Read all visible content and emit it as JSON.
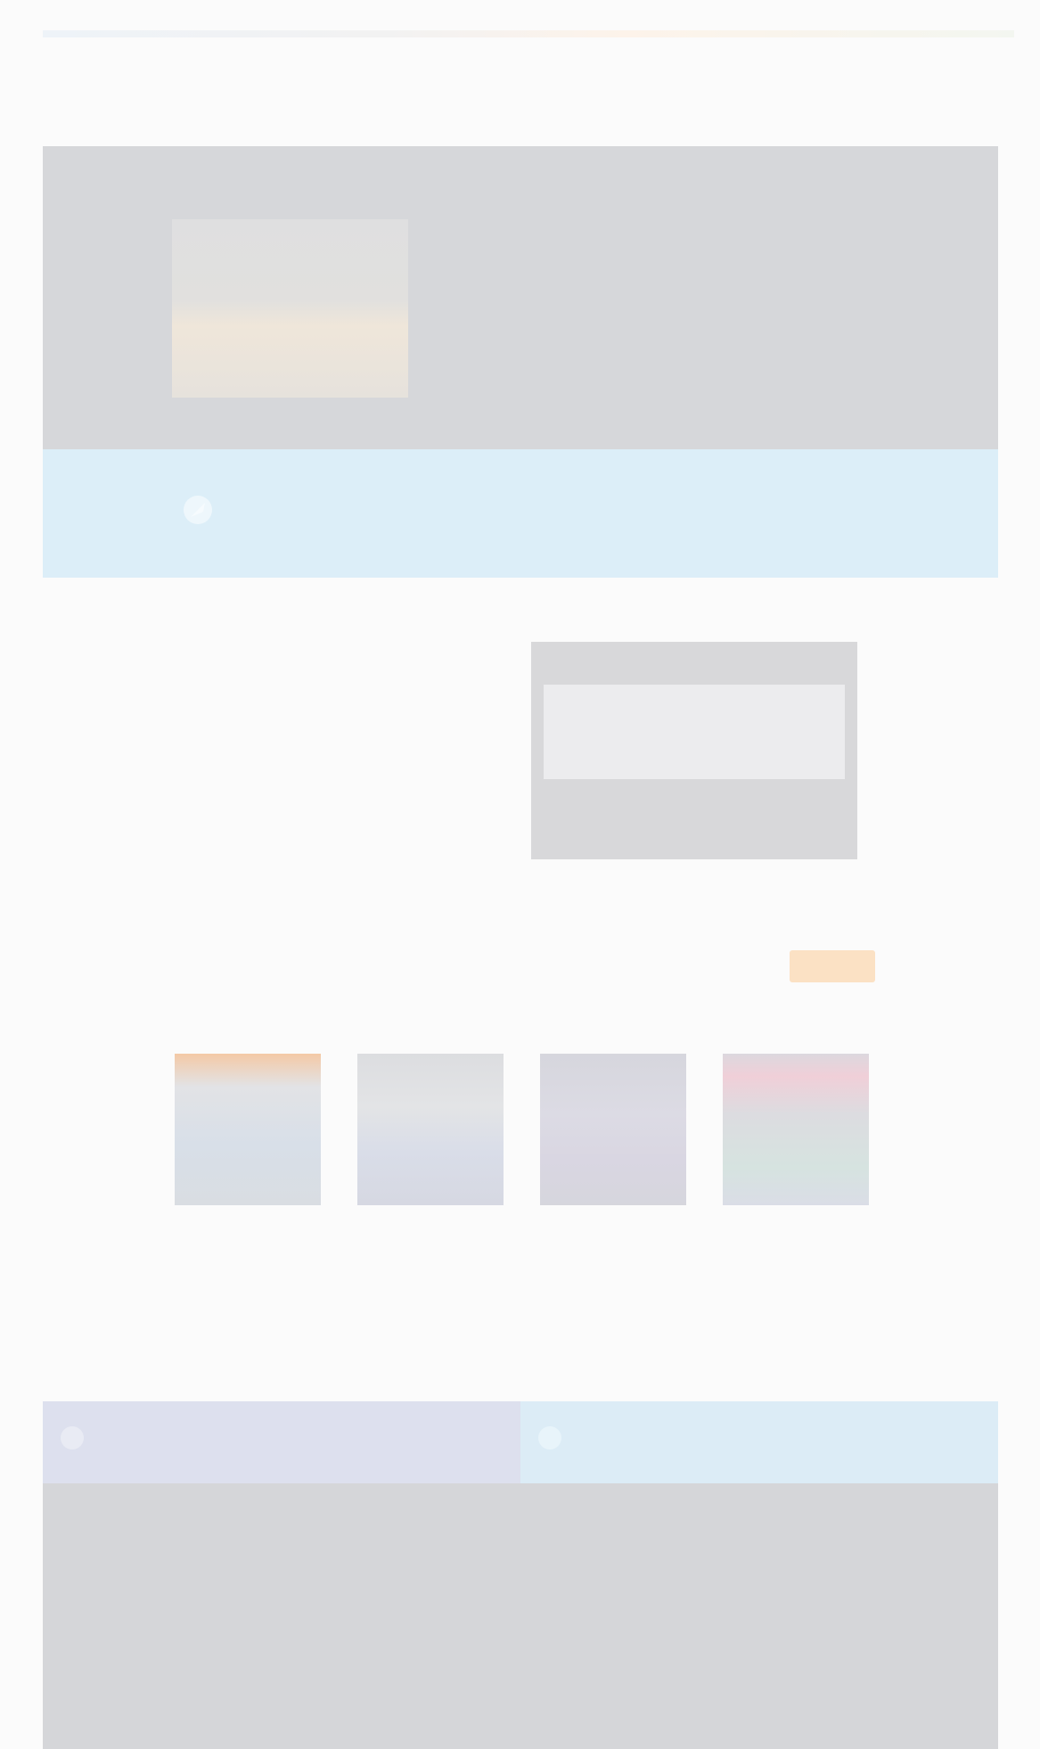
{
  "header": {
    "logo_text": "",
    "nav": [
      "",
      "",
      "",
      ""
    ]
  },
  "hero": {
    "title": "",
    "subtitle": "",
    "meta": "",
    "link": ""
  },
  "banner": {
    "text": ""
  },
  "middle": {
    "title": "",
    "items": [
      "",
      ""
    ],
    "screen_caption": ""
  },
  "section": {
    "title": "",
    "more_label": ""
  },
  "cards": [
    {
      "title": "",
      "sub": "",
      "accent": "#f4c9a6"
    },
    {
      "title": "",
      "sub": "",
      "accent": "#cfe0c8"
    },
    {
      "title": "",
      "sub": "",
      "accent": "#d9d4e6"
    },
    {
      "title": "",
      "sub": "",
      "accent": "#f2c3cf"
    }
  ],
  "tabs": [
    {
      "label": "",
      "bg": "#dde0ee"
    },
    {
      "label": "",
      "bg": "#dcecf6"
    }
  ],
  "footer": {
    "columns": [
      {
        "title": "",
        "lines": [
          "",
          ""
        ]
      },
      {
        "title": "",
        "lines": [
          "",
          ""
        ]
      },
      {
        "title": "",
        "lines": [
          "",
          ""
        ]
      },
      {
        "title": "",
        "lines": [
          "",
          ""
        ]
      }
    ],
    "copyright": ""
  },
  "colors": {
    "accent_orange": "#fbe1c4",
    "banner_blue": "#dceef8",
    "hero_gray": "#d6d7da"
  }
}
